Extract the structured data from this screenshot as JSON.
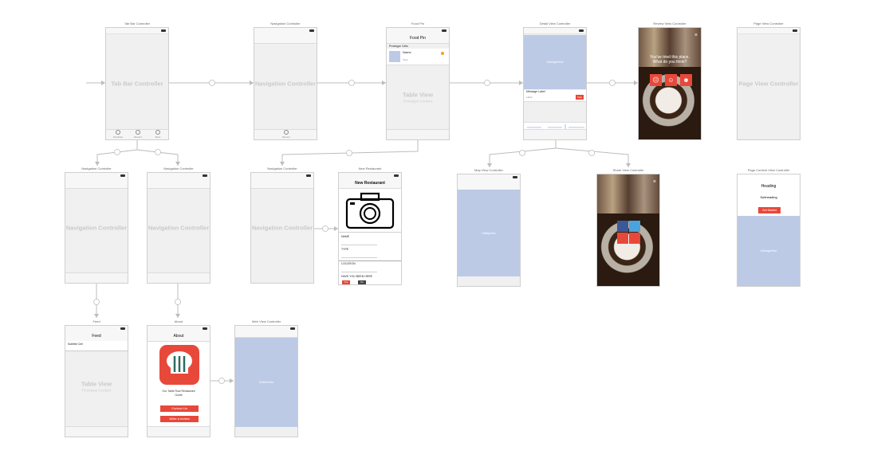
{
  "canvas": {
    "background": "#ffffff",
    "connector_color": "#b9b9b9"
  },
  "scenes": {
    "tab_bar": {
      "title": "Tab Bar Controller",
      "label": "Tab Bar Controller",
      "tabs": [
        "Favorites",
        "Recent",
        "More"
      ]
    },
    "nav_top": {
      "title": "Navigation Controller",
      "label": "Navigation Controller",
      "tab": "Recent"
    },
    "food_pin": {
      "title": "Food Pin",
      "nav_title": "Food Pin",
      "section": "Prototype Cells",
      "cell_title": "Name",
      "cell_sub": "Type",
      "label": "Table View",
      "sublabel": "Prototype Content"
    },
    "detail": {
      "title": "Detail View Controller",
      "image_label": "UIImageView",
      "field": "Message Label",
      "field2": "Label",
      "button": "Map"
    },
    "review": {
      "title": "Review View Controller",
      "text": "You've tried this place. What do you think?"
    },
    "page_view": {
      "title": "Page View Controller",
      "label": "Page View Controller"
    },
    "nav_left1": {
      "title": "Navigation Controller",
      "label": "Navigation Controller"
    },
    "nav_left2": {
      "title": "Navigation Controller",
      "label": "Navigation Controller"
    },
    "nav_mid": {
      "title": "Navigation Controller",
      "label": "Navigation Controller"
    },
    "new_restaurant": {
      "title": "New Restaurant",
      "nav_title": "New Restaurant",
      "rows": [
        "NAME",
        "TYPE",
        "LOCATION",
        "HAVE YOU BEEN HERE"
      ],
      "yes": "Yes",
      "no": "No"
    },
    "map_view": {
      "title": "Map View Controller",
      "label": "UIMapView"
    },
    "share": {
      "title": "Share View Controller"
    },
    "page_content": {
      "title": "Page Content View Controller",
      "heading": "Heading",
      "subheading": "Subheading",
      "button": "Get Started",
      "image_label": "UIImageView"
    },
    "feed": {
      "title": "Feed",
      "nav_title": "Feed",
      "cell": "Subtitle Cell",
      "label": "Table View",
      "sublabel": "Prototype Content"
    },
    "about": {
      "title": "About",
      "nav_title": "About",
      "desc": "Our Table Row Restaurant Guide",
      "btn1": "Contact Us",
      "btn2": "Write a review"
    },
    "web_view": {
      "title": "Web View Controller",
      "label": "UIWebView"
    }
  }
}
